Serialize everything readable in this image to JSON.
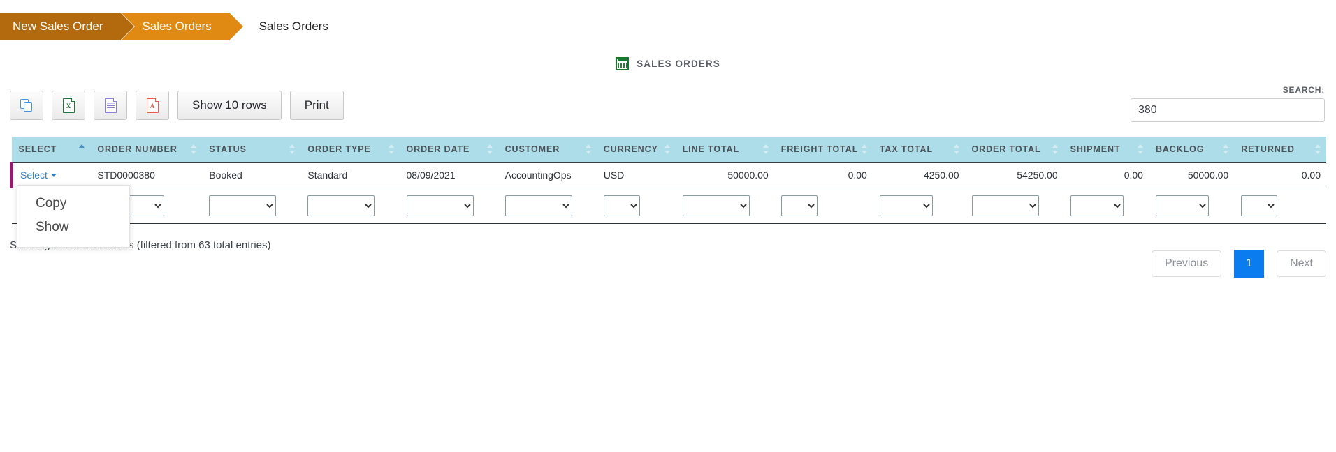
{
  "breadcrumb": {
    "step1": "New Sales Order",
    "step2": "Sales Orders",
    "current": "Sales Orders"
  },
  "page": {
    "title": "SALES ORDERS",
    "title_icon": "grid-table-icon"
  },
  "toolbar": {
    "copy_icon": "copy-icon",
    "excel_label": "X",
    "excel_icon": "excel-file-icon",
    "csv_icon": "csv-file-icon",
    "pdf_label": "A",
    "pdf_icon": "pdf-file-icon",
    "show_rows_label": "Show 10 rows",
    "print_label": "Print"
  },
  "search": {
    "label": "SEARCH:",
    "value": "380",
    "placeholder": ""
  },
  "table": {
    "columns": [
      {
        "label": "SELECT",
        "sorted": true,
        "align": "left"
      },
      {
        "label": "ORDER NUMBER",
        "sorted": false,
        "align": "left"
      },
      {
        "label": "STATUS",
        "sorted": false,
        "align": "left"
      },
      {
        "label": "ORDER TYPE",
        "sorted": false,
        "align": "left"
      },
      {
        "label": "ORDER DATE",
        "sorted": false,
        "align": "left"
      },
      {
        "label": "CUSTOMER",
        "sorted": false,
        "align": "left"
      },
      {
        "label": "CURRENCY",
        "sorted": false,
        "align": "left"
      },
      {
        "label": "LINE TOTAL",
        "sorted": false,
        "align": "right"
      },
      {
        "label": "FREIGHT TOTAL",
        "sorted": false,
        "align": "right"
      },
      {
        "label": "TAX TOTAL",
        "sorted": false,
        "align": "right"
      },
      {
        "label": "ORDER TOTAL",
        "sorted": false,
        "align": "right"
      },
      {
        "label": "SHIPMENT",
        "sorted": false,
        "align": "right"
      },
      {
        "label": "BACKLOG",
        "sorted": false,
        "align": "right"
      },
      {
        "label": "RETURNED",
        "sorted": false,
        "align": "right"
      }
    ],
    "rows": [
      {
        "select": "Select",
        "order_number": "STD0000380",
        "status": "Booked",
        "order_type": "Standard",
        "order_date": "08/09/2021",
        "customer": "AccountingOps",
        "currency": "USD",
        "line_total": "50000.00",
        "freight_total": "0.00",
        "tax_total": "4250.00",
        "order_total": "54250.00",
        "shipment": "0.00",
        "backlog": "50000.00",
        "returned": "0.00"
      }
    ],
    "filter_values": [
      "",
      "",
      "",
      "",
      "",
      "",
      "",
      "",
      "",
      "",
      "",
      "",
      "",
      ""
    ]
  },
  "dropdown": {
    "open": true,
    "items": [
      {
        "label": "Copy"
      },
      {
        "label": "Show"
      }
    ]
  },
  "footer": {
    "info": "Showing 1 to 1 of 1 entries (filtered from 63 total entries)",
    "previous_label": "Previous",
    "page_label": "1",
    "next_label": "Next"
  },
  "colors": {
    "crumb_dark": "#b3690e",
    "crumb_light": "#e08a14",
    "header_bg": "#aeddea",
    "row_accent": "#8e1d6e",
    "link": "#2e7fc1",
    "page_active": "#0b7cf0"
  }
}
